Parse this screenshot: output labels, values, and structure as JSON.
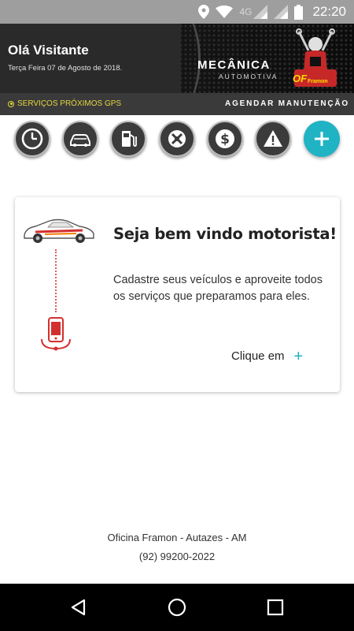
{
  "status_bar": {
    "network": "4G",
    "time": "22:20",
    "icons": [
      "location-icon",
      "wifi-icon",
      "signal-icon",
      "signal-icon",
      "battery-icon"
    ]
  },
  "header": {
    "greeting": "Olá Visitante",
    "date": "Terça Feira 07 de Agosto de 2018.",
    "brand_title": "MECÂNICA",
    "brand_subtitle": "AUTOMOTIVA",
    "logo_text": "OF",
    "logo_subtext": "Framon"
  },
  "action_bar": {
    "gps_label": "SERVIÇOS PRÓXIMOS GPS",
    "schedule_label": "AGENDAR MANUTENÇÃO"
  },
  "quick_actions": [
    {
      "icon": "clock-icon"
    },
    {
      "icon": "car-icon"
    },
    {
      "icon": "fuel-pump-icon"
    },
    {
      "icon": "tools-icon"
    },
    {
      "icon": "dollar-icon"
    },
    {
      "icon": "warning-icon"
    },
    {
      "icon": "plus-icon"
    }
  ],
  "welcome_card": {
    "title": "Seja bem vindo motorista!",
    "body": "Cadastre seus veículos e aproveite todos os serviços que preparamos para eles.",
    "cta": "Clique em",
    "cta_symbol": "+"
  },
  "footer": {
    "company": "Oficina Framon - Autazes - AM",
    "phone": "(92) 99200-2022"
  },
  "colors": {
    "accent": "#1fb3c4",
    "header_bg": "#262626",
    "gps_text": "#e6d640",
    "illustration_red": "#d32f2f"
  }
}
